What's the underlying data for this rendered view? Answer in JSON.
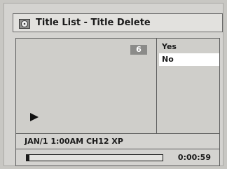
{
  "header": {
    "title": "Title List - Title Delete",
    "icon": "disc-icon"
  },
  "preview": {
    "title_number": "6",
    "play_icon": "play-icon"
  },
  "menu": {
    "items": [
      {
        "label": "Yes",
        "selected": false
      },
      {
        "label": "No",
        "selected": true
      }
    ]
  },
  "info": {
    "details": "JAN/1 1:00AM CH12 XP"
  },
  "playback": {
    "elapsed": "0:00:59",
    "progress": 0.02
  },
  "colors": {
    "background": "#c8c7c3",
    "selected_item": "#ffffff",
    "badge": "#8b8b89"
  }
}
